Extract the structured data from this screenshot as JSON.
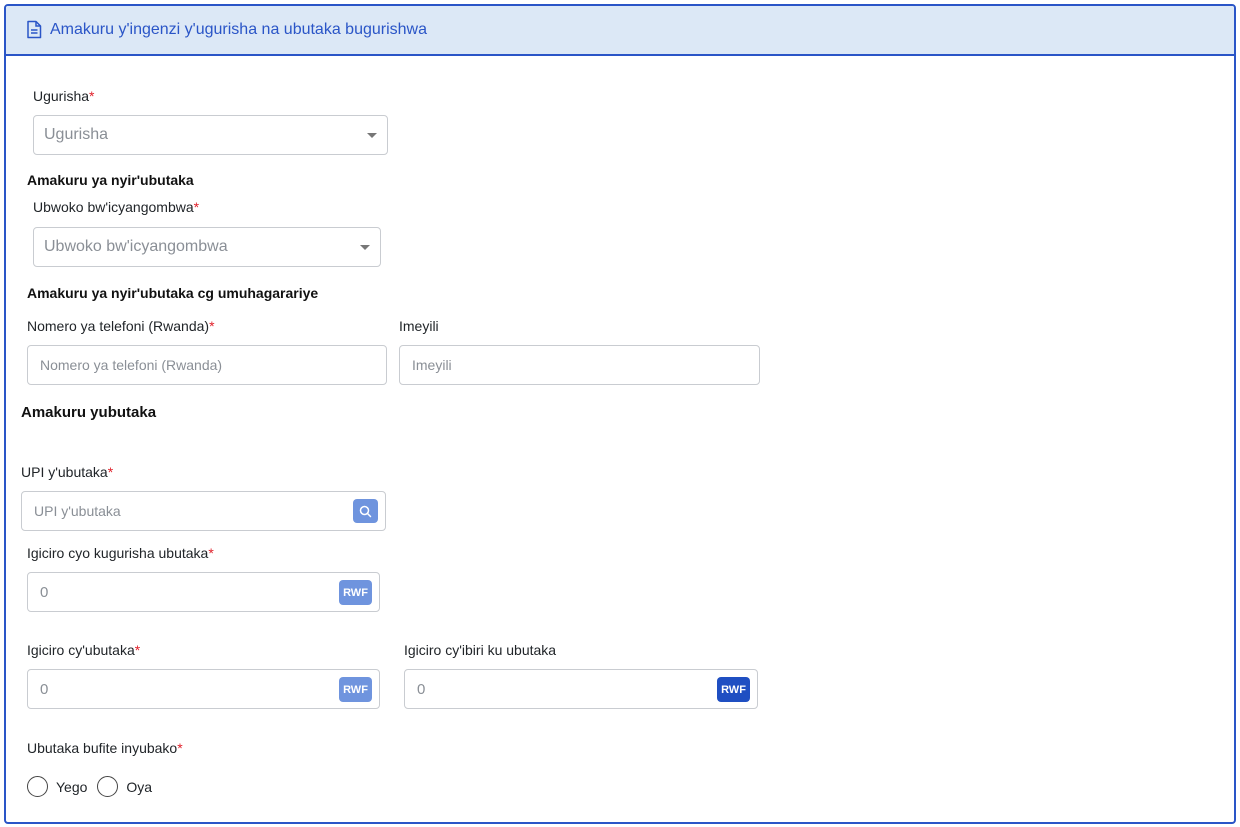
{
  "header": {
    "title": "Amakuru y'ingenzi y'ugurisha na ubutaka bugurishwa",
    "icon": "document-icon"
  },
  "seller": {
    "label": "Ugurisha",
    "required": "*",
    "placeholder": "Ugurisha"
  },
  "owner_section": {
    "title": "Amakuru ya nyir'ubutaka",
    "doc_type_label": "Ubwoko bw'icyangombwa",
    "doc_type_required": "*",
    "doc_type_placeholder": "Ubwoko bw'icyangombwa"
  },
  "contact_section": {
    "title": "Amakuru ya nyir'ubutaka cg umuhagarariye",
    "phone_label": "Nomero ya telefoni (Rwanda)",
    "phone_required": "*",
    "phone_placeholder": "Nomero ya telefoni (Rwanda)",
    "email_label": "Imeyili",
    "email_placeholder": "Imeyili"
  },
  "land_section": {
    "title": "Amakuru yubutaka",
    "upi_label": "UPI y'ubutaka",
    "upi_required": "*",
    "upi_placeholder": "UPI y'ubutaka",
    "sale_price_label": "Igiciro cyo kugurisha ubutaka",
    "sale_price_required": "*",
    "sale_price_placeholder": "0",
    "land_price_label": "Igiciro cy'ubutaka",
    "land_price_required": "*",
    "land_price_placeholder": "0",
    "other_price_label": "Igiciro cy'ibiri ku ubutaka",
    "other_price_placeholder": "0",
    "currency": "RWF",
    "building_label": "Ubutaka bufite inyubako",
    "building_required": "*",
    "yes_label": "Yego",
    "no_label": "Oya"
  },
  "colors": {
    "accent": "#2a55c7",
    "header_bg": "#dce8f6",
    "badge": "#6f94de",
    "badge_dark": "#1f4fc2",
    "required": "#e0202a"
  }
}
